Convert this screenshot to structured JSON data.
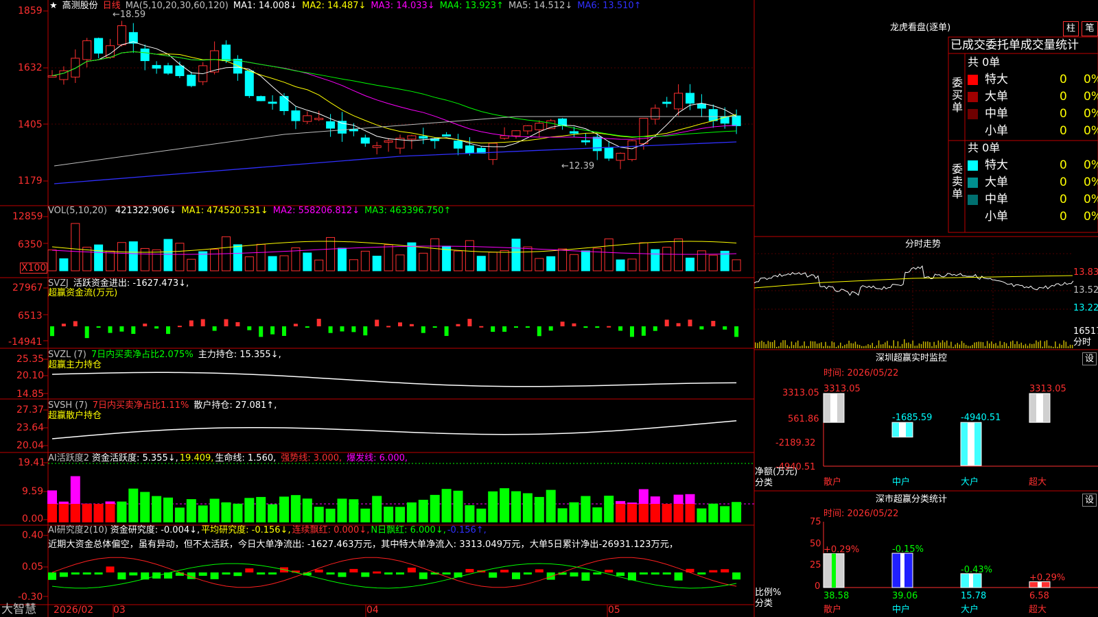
{
  "main": {
    "star": "★",
    "stock_name": "高测股份",
    "period": "日线",
    "ma_prefix": "MA(5,10,20,30,60,120)",
    "ma_items": [
      {
        "text": "MA1: 14.008↓",
        "color": "#ffffff"
      },
      {
        "text": "MA2: 14.487↓",
        "color": "#ffff00"
      },
      {
        "text": "MA3: 14.033↓",
        "color": "#ff00ff"
      },
      {
        "text": "MA4: 13.923↑",
        "color": "#00ff00"
      },
      {
        "text": "MA5: 14.512↓",
        "color": "#c0c0c0"
      },
      {
        "text": "MA6: 13.510↑",
        "color": "#0000ff"
      }
    ],
    "high_note": "←18.59",
    "low_note": "←12.39",
    "y_ticks": [
      "1859",
      "1632",
      "1405",
      "1179"
    ],
    "corner_label": "X100"
  },
  "volume": {
    "prefix": "VOL(5,10,20)",
    "value": "421322.906↓",
    "items": [
      {
        "text": "MA1: 474520.531↓",
        "color": "#ffff00"
      },
      {
        "text": "MA2: 558206.812↓",
        "color": "#ff00ff"
      },
      {
        "text": "MA3: 463396.750↑",
        "color": "#00ff00"
      }
    ],
    "y_ticks": [
      "12859",
      "6350"
    ]
  },
  "svzj": {
    "prefix": "SVZJ",
    "text": "活跃资金进出: -1627.473↓,",
    "name": "超赢资金流(万元)",
    "y_ticks": [
      "27967",
      "6513",
      "-14941"
    ]
  },
  "svzl": {
    "prefix": "SVZL (7)",
    "text_green": "7日内买卖净占比2.075%",
    "text_white": "主力持仓: 15.355↓,",
    "name": "超赢主力持仓",
    "y_ticks": [
      "25.35",
      "20.10",
      "14.85"
    ]
  },
  "svsh": {
    "prefix": "SVSH (7)",
    "text_red": "7日内买卖净占比1.11%",
    "text_white": "散户持仓: 27.081↑,",
    "name": "超赢散户持仓",
    "y_ticks": [
      "27.37",
      "23.64",
      "20.04"
    ]
  },
  "active": {
    "prefix": "AI活跃度2",
    "t1": "资金活跃度: 5.355↓,",
    "t2": "19.409,",
    "t3": "生命线: 1.560,",
    "t4": "强势线: 3.000,",
    "t5": "爆发线: 6.000,",
    "y_ticks": [
      "19.41",
      "9.59",
      "0.00"
    ]
  },
  "research": {
    "prefix": "AI研究度2(10)",
    "t1": "资金研究度: -0.004↓,",
    "t2": "平均研究度: -0.156↓,",
    "t3": "连续飘红: 0.000↓,",
    "t4": "N日飘红: 6.000↓,",
    "t5": "-0.156↑,",
    "comment": "近期大资金总体偏空，虽有异动，但不太活跃，今日大单净流出: -1627.463万元，其中特大单净流入: 3313.049万元，大单5日累计净出-26931.123万元，",
    "y_ticks": [
      "0.40",
      "0.05",
      "-0.30"
    ]
  },
  "bottom": {
    "logo": "大智慧",
    "dates": [
      "2026/02",
      "03",
      "04",
      "05"
    ]
  },
  "right": {
    "dragon_title": "龙虎看盘(逐单)",
    "btn_zhu": "柱",
    "btn_bi": "笔",
    "tabs": "已成交委托单成交量统计",
    "buy_label": [
      "委",
      "买",
      "单"
    ],
    "sell_label": [
      "委",
      "卖",
      "单"
    ],
    "buy_total": "共 0单",
    "sell_total": "共 0单",
    "buy_rows": [
      {
        "name": "特大",
        "count": "0",
        "pct": "0%",
        "color": "#ff0000"
      },
      {
        "name": "大单",
        "count": "0",
        "pct": "0%",
        "color": "#a00000"
      },
      {
        "name": "中单",
        "count": "0",
        "pct": "0%",
        "color": "#700000"
      },
      {
        "name": "小单",
        "count": "0",
        "pct": "0%",
        "color": ""
      }
    ],
    "sell_rows": [
      {
        "name": "特大",
        "count": "0",
        "pct": "0%",
        "color": "#00ffff"
      },
      {
        "name": "大单",
        "count": "0",
        "pct": "0%",
        "color": "#008f8f"
      },
      {
        "name": "中单",
        "count": "0",
        "pct": "0%",
        "color": "#006f6f"
      },
      {
        "name": "小单",
        "count": "0",
        "pct": "0%",
        "color": ""
      }
    ],
    "intraday_title": "分时走势",
    "intraday_ticks": [
      "13.83",
      "13.52",
      "13.22",
      "16517",
      "分时"
    ],
    "monitor_title": "深圳超赢实时监控",
    "settings": "设",
    "monitor_time": "时间: 2026/05/22",
    "monitor_ticks": [
      "3313.05",
      "561.86",
      "-2189.32",
      "-4940.51"
    ],
    "monitor_ylabel": [
      "净额(万元)",
      "分类"
    ],
    "class_title": "深市超赢分类统计",
    "class_time": "时间: 2026/05/22",
    "class_ticks": [
      "75",
      "50",
      "25",
      "0"
    ],
    "class_ylabel": [
      "比例%",
      "分类"
    ],
    "categories": [
      "散户",
      "中户",
      "大户",
      "超大"
    ]
  },
  "monitor_chart": {
    "type": "bar",
    "categories": [
      "散户",
      "中户",
      "大户",
      "超大"
    ],
    "values": [
      3313.05,
      -1685.59,
      -4940.51,
      3313.05
    ],
    "labels": [
      "3313.05",
      "-1685.59",
      "-4940.51",
      "3313.05"
    ],
    "ylim": [
      -4940.51,
      3313.05
    ]
  },
  "class_chart": {
    "type": "bar",
    "categories": [
      "散户",
      "中户",
      "大户",
      "超大"
    ],
    "values": [
      38.58,
      39.06,
      15.78,
      6.58
    ],
    "value_labels": [
      "38.58",
      "39.06",
      "15.78",
      "6.58"
    ],
    "pct_labels": [
      "+0.29%",
      "-0.15%",
      "-0.43%",
      "+0.29%"
    ],
    "ylim": [
      0,
      75
    ]
  }
}
